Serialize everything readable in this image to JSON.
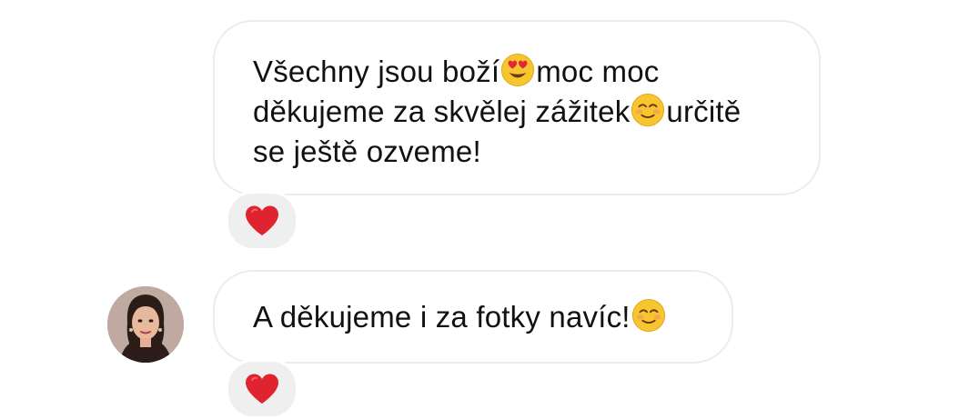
{
  "messages": [
    {
      "lines": [
        {
          "before": "Všechny jsou boží",
          "emoji": "heart-eyes-emoji",
          "after": "moc moc"
        },
        {
          "before": "děkujeme za skvělej zážitek",
          "emoji": "smiling-blush-emoji",
          "after": "určitě"
        },
        {
          "before": "se ještě ozveme!",
          "emoji": "",
          "after": ""
        }
      ],
      "reaction": "red-heart"
    },
    {
      "lines": [
        {
          "before": "A děkujeme i za fotky navíc!",
          "emoji": "smiling-blush-emoji",
          "after": ""
        }
      ],
      "reaction": "red-heart",
      "avatar": "user-avatar-photo"
    }
  ],
  "colors": {
    "bubble_border": "#ececec",
    "reaction_bg": "#efefef",
    "heart": "#e0242f",
    "text": "#111111"
  }
}
